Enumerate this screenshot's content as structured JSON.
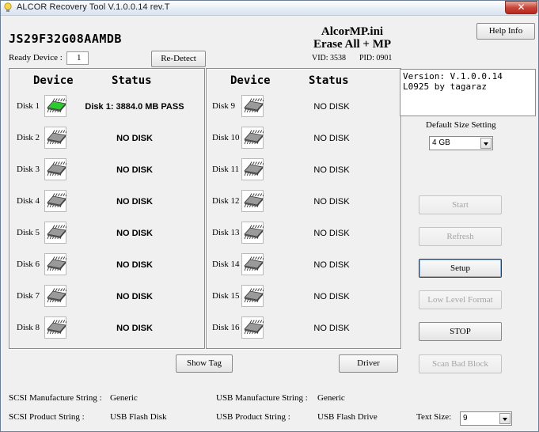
{
  "window": {
    "title": "ALCOR Recovery Tool V.1.0.0.14 rev.T",
    "close_label": "✕"
  },
  "header": {
    "model": "JS29F32G08AAMDB",
    "ini_title": "AlcorMP.ini",
    "ini_mode": "Erase All + MP",
    "vid": "VID: 3538",
    "pid": "PID: 0901",
    "help_label": "Help Info",
    "ready_label": "Ready Device :",
    "ready_value": "1",
    "redetect_label": "Re-Detect"
  },
  "table": {
    "device_header": "Device",
    "status_header": "Status",
    "left": [
      {
        "label": "Disk 1",
        "status": "Disk 1: 3884.0 MB PASS",
        "state": "pass"
      },
      {
        "label": "Disk 2",
        "status": "NO DISK",
        "state": "none"
      },
      {
        "label": "Disk 3",
        "status": "NO DISK",
        "state": "none"
      },
      {
        "label": "Disk 4",
        "status": "NO DISK",
        "state": "none"
      },
      {
        "label": "Disk 5",
        "status": "NO DISK",
        "state": "none"
      },
      {
        "label": "Disk 6",
        "status": "NO DISK",
        "state": "none"
      },
      {
        "label": "Disk 7",
        "status": "NO DISK",
        "state": "none"
      },
      {
        "label": "Disk 8",
        "status": "NO DISK",
        "state": "none"
      }
    ],
    "right": [
      {
        "label": "Disk 9",
        "status": "NO DISK",
        "state": "none"
      },
      {
        "label": "Disk 10",
        "status": "NO DISK",
        "state": "none"
      },
      {
        "label": "Disk 11",
        "status": "NO DISK",
        "state": "none"
      },
      {
        "label": "Disk 12",
        "status": "NO DISK",
        "state": "none"
      },
      {
        "label": "Disk 13",
        "status": "NO DISK",
        "state": "none"
      },
      {
        "label": "Disk 14",
        "status": "NO DISK",
        "state": "none"
      },
      {
        "label": "Disk 15",
        "status": "NO DISK",
        "state": "none"
      },
      {
        "label": "Disk 16",
        "status": "NO DISK",
        "state": "none"
      }
    ]
  },
  "version_box": {
    "line1": "Version: V.1.0.0.14",
    "line2": "L0925 by tagaraz"
  },
  "size": {
    "label": "Default Size Setting",
    "value": "4 GB"
  },
  "buttons": {
    "start": "Start",
    "refresh": "Refresh",
    "setup": "Setup",
    "low_level_format": "Low Level Format",
    "stop": "STOP",
    "scan_bad_block": "Scan Bad Block",
    "show_tag": "Show Tag",
    "driver": "Driver"
  },
  "footer": {
    "scsi_mfr_label": "SCSI Manufacture String :",
    "scsi_mfr_value": "Generic",
    "usb_mfr_label": "USB Manufacture String :",
    "usb_mfr_value": "Generic",
    "scsi_prod_label": "SCSI Product String :",
    "scsi_prod_value": "USB Flash Disk",
    "usb_prod_label": "USB Product String :",
    "usb_prod_value": "USB Flash Drive",
    "text_size_label": "Text Size:",
    "text_size_value": "9"
  },
  "colors": {
    "chip_pass": "#2ec92e",
    "chip_idle": "#9a9a9a",
    "close_red": "#c7483a"
  }
}
